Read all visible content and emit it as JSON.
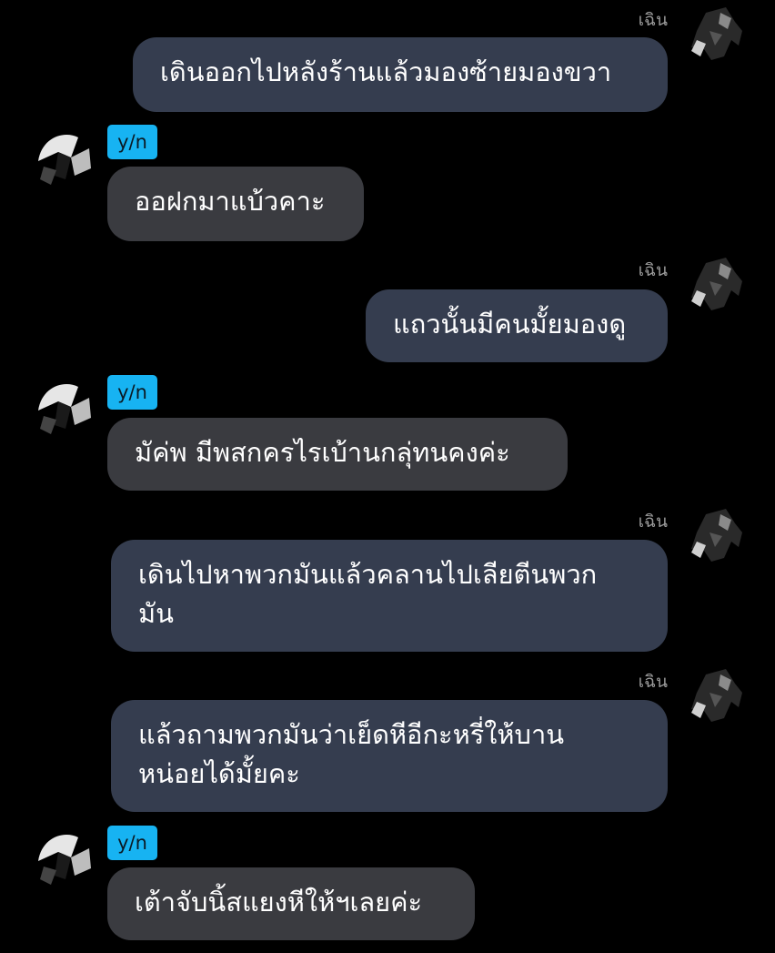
{
  "conversation": {
    "messages": [
      {
        "side": "right",
        "sender": "เฉิน",
        "text": "เดินออกไปหลังร้านแล้วมองซ้ายมองขวา"
      },
      {
        "side": "left",
        "sender": "y/n",
        "text": "ออฝกมาแบ้วคาะ"
      },
      {
        "side": "right",
        "sender": "เฉิน",
        "text": "แถวนั้นมีคนมั้ยมองดู"
      },
      {
        "side": "left",
        "sender": "y/n",
        "text": "มัค่พ มีพสกครไรเบ้านกลุ่ทนคงค่ะ"
      },
      {
        "side": "right",
        "sender": "เฉิน",
        "text": "เดินไปหาพวกมันแล้วคลานไปเลียตีนพวกมัน"
      },
      {
        "side": "right",
        "sender": "เฉิน",
        "text": "แล้วถามพวกมันว่าเย็ดหีอีกะหรี่ให้บานหน่อยได้มั้ยคะ"
      },
      {
        "side": "left",
        "sender": "y/n",
        "text": "เต้าจับนิ้สแยงหีให้ฯเลยค่ะ"
      }
    ]
  },
  "colors": {
    "background": "#000000",
    "right_bubble": "#353d4f",
    "left_bubble": "#3a3b40",
    "tag": "#17b3f2",
    "name": "#9a9a9a"
  },
  "icons": [
    "avatar-chen",
    "avatar-yn"
  ]
}
